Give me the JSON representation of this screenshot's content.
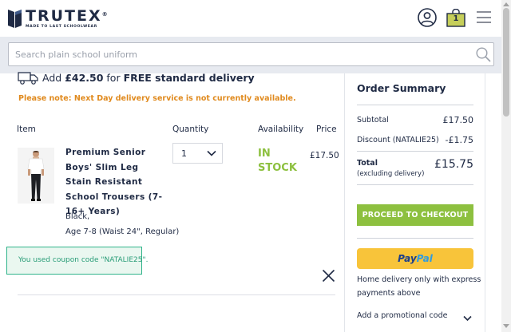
{
  "header": {
    "brand": "TRUTEX",
    "brand_mark": "®",
    "tagline": "MADE TO LAST SCHOOLWEAR",
    "basket_count": "1",
    "icons": {
      "account": "user-icon",
      "basket": "basket-icon",
      "menu": "hamburger-menu-icon"
    }
  },
  "search": {
    "placeholder": "Search plain school uniform",
    "icon": "search-icon"
  },
  "delivery": {
    "prefix": "Add ",
    "amount": "£42.50",
    "middle": " for ",
    "offer": "FREE standard delivery",
    "icon": "truck-icon",
    "note": "Please note: Next Day delivery service is not currently available."
  },
  "table": {
    "headers": {
      "item": "Item",
      "quantity": "Quantity",
      "availability": "Availability",
      "price": "Price"
    },
    "rows": [
      {
        "name": "Premium Senior Boys' Slim Leg Stain Resistant School Trousers (7-16+ Years)",
        "colour": "Black,",
        "size": "Age 7-8 (Waist 24\", Regular)",
        "quantity": "1",
        "availability": "IN STOCK",
        "price": "£17.50"
      }
    ]
  },
  "coupon_alert": "You used coupon code \"NATALIE25\".",
  "summary": {
    "title": "Order Summary",
    "subtotal_label": "Subtotal",
    "subtotal_value": "£17.50",
    "discount_label": "Discount (NATALIE25)",
    "discount_value": "-£1.75",
    "total_label": "Total",
    "total_note": "(excluding delivery)",
    "total_value": "£15.75",
    "checkout_label": "PROCEED TO CHECKOUT",
    "paypal_part1": "Pay",
    "paypal_part2": "Pal",
    "paypal_note": "Home delivery only with express payments above",
    "promo_label": "Add a promotional code"
  },
  "colors": {
    "brand_navy": "#1f2a44",
    "accent_green": "#8dc03f",
    "warning_orange": "#e08a1e",
    "alert_green": "#2fb38a",
    "paypal_yellow": "#f8c43a"
  }
}
